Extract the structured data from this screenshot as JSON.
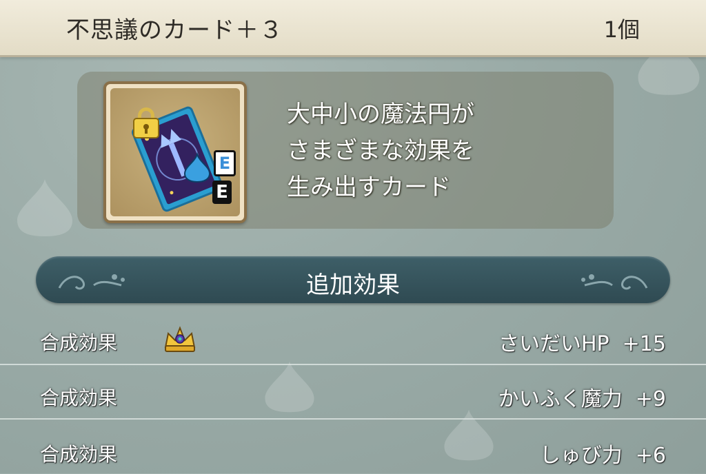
{
  "header": {
    "item_name": "不思議のカード＋３",
    "quantity": "1個"
  },
  "item": {
    "icon": "magic-circle-card-icon",
    "badge_letters": [
      "E",
      "E"
    ],
    "description": "大中小の魔法円が\nさまざまな効果を\n生み出すカード"
  },
  "section": {
    "title": "追加効果"
  },
  "effects": [
    {
      "label": "合成効果",
      "value": "さいだいHP  +15",
      "crown": true
    },
    {
      "label": "合成効果",
      "value": "かいふく魔力  +9",
      "crown": false
    },
    {
      "label": "合成効果",
      "value": "しゅび力  +6",
      "crown": false
    }
  ],
  "colors": {
    "banner": "#2f4a52",
    "header": "#ebe5d1",
    "panel": "#7a7a64",
    "card_frame": "#8a7048"
  }
}
